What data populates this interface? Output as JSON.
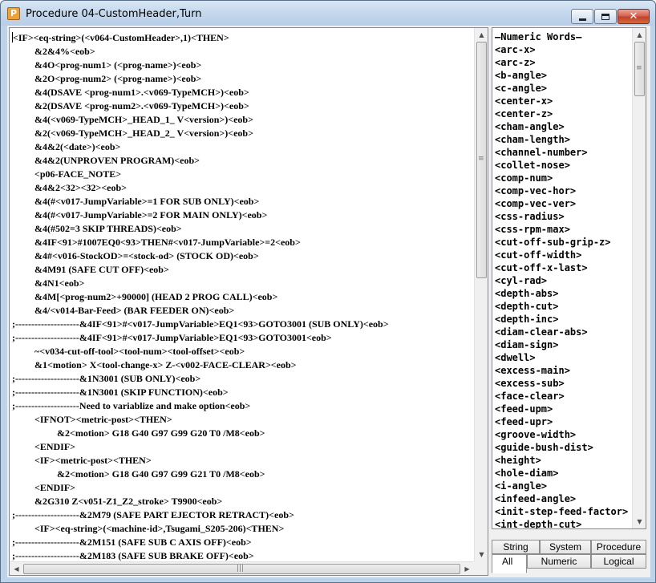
{
  "window": {
    "title": "Procedure 04-CustomHeader,Turn",
    "icon_letter": "P",
    "buttons": {
      "minimize": "minimize-icon",
      "maximize": "maximize-icon",
      "close": "close-icon"
    }
  },
  "editor": {
    "lines": [
      {
        "text": "<IF><eq-string>(<v064-CustomHeader>,1)<THEN>",
        "indent": 0
      },
      {
        "text": "&2&4%<eob>",
        "indent": 1
      },
      {
        "text": "&4O<prog-num1> (<prog-name>)<eob>",
        "indent": 1
      },
      {
        "text": "&2O<prog-num2> (<prog-name>)<eob>",
        "indent": 1
      },
      {
        "text": "&4(DSAVE <prog-num1>.<v069-TypeMCH>)<eob>",
        "indent": 1
      },
      {
        "text": "&2(DSAVE <prog-num2>.<v069-TypeMCH>)<eob>",
        "indent": 1
      },
      {
        "text": "&4(<v069-TypeMCH>_HEAD_1_ V<version>)<eob>",
        "indent": 1
      },
      {
        "text": "&2(<v069-TypeMCH>_HEAD_2_ V<version>)<eob>",
        "indent": 1
      },
      {
        "text": "&4&2(<date>)<eob>",
        "indent": 1
      },
      {
        "text": "&4&2(UNPROVEN PROGRAM)<eob>",
        "indent": 1
      },
      {
        "text": "<p06-FACE_NOTE>",
        "indent": 1
      },
      {
        "text": "&4&2<32><32><eob>",
        "indent": 1
      },
      {
        "text": "&4(#<v017-JumpVariable>=1 FOR SUB ONLY)<eob>",
        "indent": 1
      },
      {
        "text": "&4(#<v017-JumpVariable>=2 FOR MAIN ONLY)<eob>",
        "indent": 1
      },
      {
        "text": "&4(#502=3 SKIP THREADS)<eob>",
        "indent": 1
      },
      {
        "text": "&4IF<91>#1007EQ0<93>THEN#<v017-JumpVariable>=2<eob>",
        "indent": 1
      },
      {
        "text": "&4#<v016-StockOD>=<stock-od> (STOCK OD)<eob>",
        "indent": 1
      },
      {
        "text": "&4M91 (SAFE CUT OFF)<eob>",
        "indent": 1
      },
      {
        "text": "&4N1<eob>",
        "indent": 1
      },
      {
        "text": "&4M[<prog-num2>+90000] (HEAD 2 PROG CALL)<eob>",
        "indent": 1
      },
      {
        "text": "&4/<v014-Bar-Feed> (BAR FEEDER ON)<eob>",
        "indent": 1
      },
      {
        "text": ";--------------------&4IF<91>#<v017-JumpVariable>EQ1<93>GOTO3001 (SUB ONLY)<eob>",
        "indent": 0
      },
      {
        "text": ";--------------------&4IF<91>#<v017-JumpVariable>EQ1<93>GOTO3001<eob>",
        "indent": 0
      },
      {
        "text": "~<v034-cut-off-tool><tool-num><tool-offset><eob>",
        "indent": 1
      },
      {
        "text": "&1<motion> X<tool-change-x> Z-<v002-FACE-CLEAR><eob>",
        "indent": 1
      },
      {
        "text": ";--------------------&1N3001 (SUB ONLY)<eob>",
        "indent": 0
      },
      {
        "text": ";--------------------&1N3001 (SKIP FUNCTION)<eob>",
        "indent": 0
      },
      {
        "text": ";--------------------Need to variablize and make option<eob>",
        "indent": 0
      },
      {
        "text": "<IFNOT><metric-post><THEN>",
        "indent": 1
      },
      {
        "text": "&2<motion> G18 G40 G97 G99 G20 T0 /M8<eob>",
        "indent": 2
      },
      {
        "text": "<ENDIF>",
        "indent": 1
      },
      {
        "text": "<IF><metric-post><THEN>",
        "indent": 1
      },
      {
        "text": "&2<motion> G18 G40 G97 G99 G21 T0 /M8<eob>",
        "indent": 2
      },
      {
        "text": "<ENDIF>",
        "indent": 1
      },
      {
        "text": "&2G310 Z<v051-Z1_Z2_stroke> T9900<eob>",
        "indent": 1
      },
      {
        "text": ";--------------------&2M79 (SAFE PART EJECTOR RETRACT)<eob>",
        "indent": 0
      },
      {
        "text": "<IF><eq-string>(<machine-id>,Tsugami_S205-206)<THEN>",
        "indent": 1
      },
      {
        "text": ";--------------------&2M151 (SAFE SUB C AXIS OFF)<eob>",
        "indent": 0
      },
      {
        "text": ";--------------------&2M183 (SAFE SUB BRAKE OFF)<eob>",
        "indent": 0
      }
    ],
    "vscroll_position": 0.0,
    "hscroll_position": 0.0
  },
  "word_list": {
    "header": "—Numeric Words—",
    "items": [
      "<arc-x>",
      "<arc-z>",
      "<b-angle>",
      "<c-angle>",
      "<center-x>",
      "<center-z>",
      "<cham-angle>",
      "<cham-length>",
      "<channel-number>",
      "<collet-nose>",
      "<comp-num>",
      "<comp-vec-hor>",
      "<comp-vec-ver>",
      "<css-radius>",
      "<css-rpm-max>",
      "<cut-off-sub-grip-z>",
      "<cut-off-width>",
      "<cut-off-x-last>",
      "<cyl-rad>",
      "<depth-abs>",
      "<depth-cut>",
      "<depth-inc>",
      "<diam-clear-abs>",
      "<diam-sign>",
      "<dwell>",
      "<excess-main>",
      "<excess-sub>",
      "<face-clear>",
      "<feed-upm>",
      "<feed-upr>",
      "<groove-width>",
      "<guide-bush-dist>",
      "<height>",
      "<hole-diam>",
      "<i-angle>",
      "<infeed-angle>",
      "<init-step-feed-factor>",
      "<int-depth-cut>"
    ],
    "vscroll_position": 0.0
  },
  "tabs": {
    "row1": [
      "String",
      "System",
      "Procedure"
    ],
    "row2": [
      "All",
      "Numeric",
      "Logical"
    ],
    "active": "All"
  },
  "colors": {
    "title_bar": "#c2d6ec",
    "close_button": "#c2402d",
    "text": "#000000"
  }
}
